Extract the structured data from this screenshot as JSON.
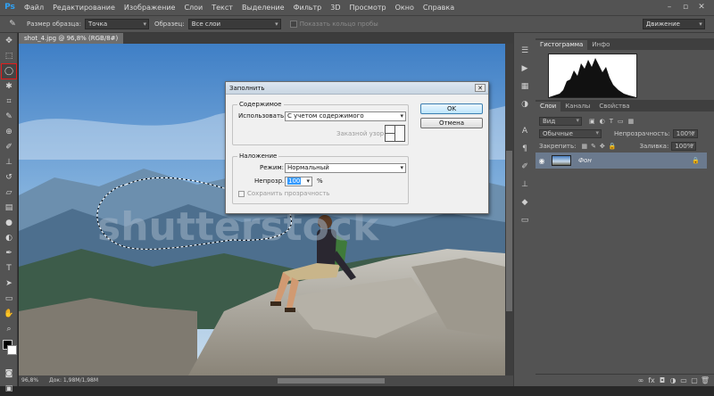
{
  "app": {
    "logo": "Ps"
  },
  "menu": [
    "Файл",
    "Редактирование",
    "Изображение",
    "Слои",
    "Текст",
    "Выделение",
    "Фильтр",
    "3D",
    "Просмотр",
    "Окно",
    "Справка"
  ],
  "window_controls": {
    "minimize": "–",
    "restore": "▫",
    "close": "✕"
  },
  "options": {
    "sample_size_label": "Размер образца:",
    "sample_size_value": "Точка",
    "sample_label": "Образец:",
    "sample_value": "Все слои",
    "show_ring_label": "Показать кольцо пробы",
    "workspace_value": "Движение"
  },
  "document": {
    "tab_title": "shot_4.jpg @ 96,8% (RGB/8#)",
    "zoom": "96,8%",
    "doc_size": "Док: 1,98M/1,98M",
    "watermark": "shutterstock"
  },
  "panels": {
    "tabs_top": [
      "Гистограмма",
      "Инфо"
    ],
    "tabs_layers": [
      "Слои",
      "Каналы",
      "Свойства"
    ],
    "kind_value": "Вид",
    "blend_value": "Обычные",
    "opacity_label": "Непрозрачность:",
    "opacity_value": "100%",
    "lock_label": "Закрепить:",
    "fill_label": "Заливка:",
    "fill_value": "100%",
    "layer_name": "Фон"
  },
  "dialog": {
    "title": "Заполнить",
    "close": "✕",
    "content_legend": "Содержимое",
    "use_label": "Использовать:",
    "use_value": "С учетом содержимого",
    "pattern_label": "Заказной узор:",
    "ok_label": "OK",
    "cancel_label": "Отмена",
    "blending_legend": "Наложение",
    "mode_label": "Режим:",
    "mode_value": "Нормальный",
    "opacity_label": "Непрозр.:",
    "opacity_value": "100",
    "opacity_unit": "%",
    "preserve_label": "Сохранить прозрачность"
  },
  "colors": {
    "accent_blue": "#2fa3f7",
    "selection_red": "#e21b1b"
  }
}
